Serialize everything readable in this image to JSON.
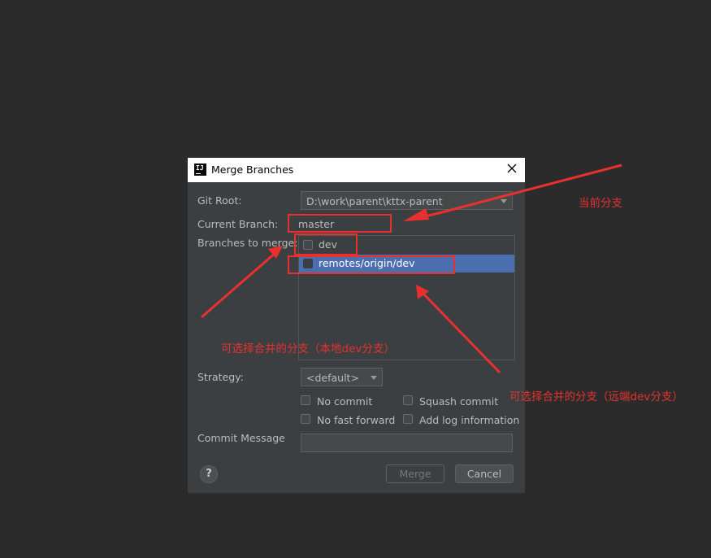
{
  "dialog": {
    "title": "Merge Branches",
    "git_root_label": "Git Root:",
    "git_root_value": "D:\\work\\parent\\kttx-parent",
    "current_branch_label": "Current Branch:",
    "current_branch_value": "master",
    "branches_label": "Branches to merge:",
    "branches": [
      {
        "label": "dev",
        "checked": false,
        "selected": false
      },
      {
        "label": "remotes/origin/dev",
        "checked": false,
        "selected": true
      }
    ],
    "strategy_label": "Strategy:",
    "strategy_value": "<default>",
    "options": {
      "no_commit": "No commit",
      "squash_commit": "Squash commit",
      "no_fast_forward": "No fast forward",
      "add_log_information": "Add log information"
    },
    "commit_message_label": "Commit Message",
    "commit_message_value": "",
    "help_label": "?",
    "merge_button": "Merge",
    "cancel_button": "Cancel"
  },
  "annotations": {
    "current_branch_note": "当前分支",
    "local_branch_note": "可选择合并的分支（本地dev分支）",
    "remote_branch_note": "可选择合并的分支（远端dev分支）"
  },
  "colors": {
    "background": "#2b2b2b",
    "dialog_bg": "#3c3f41",
    "selection": "#4b6eaf",
    "annotation": "#e8312f"
  }
}
